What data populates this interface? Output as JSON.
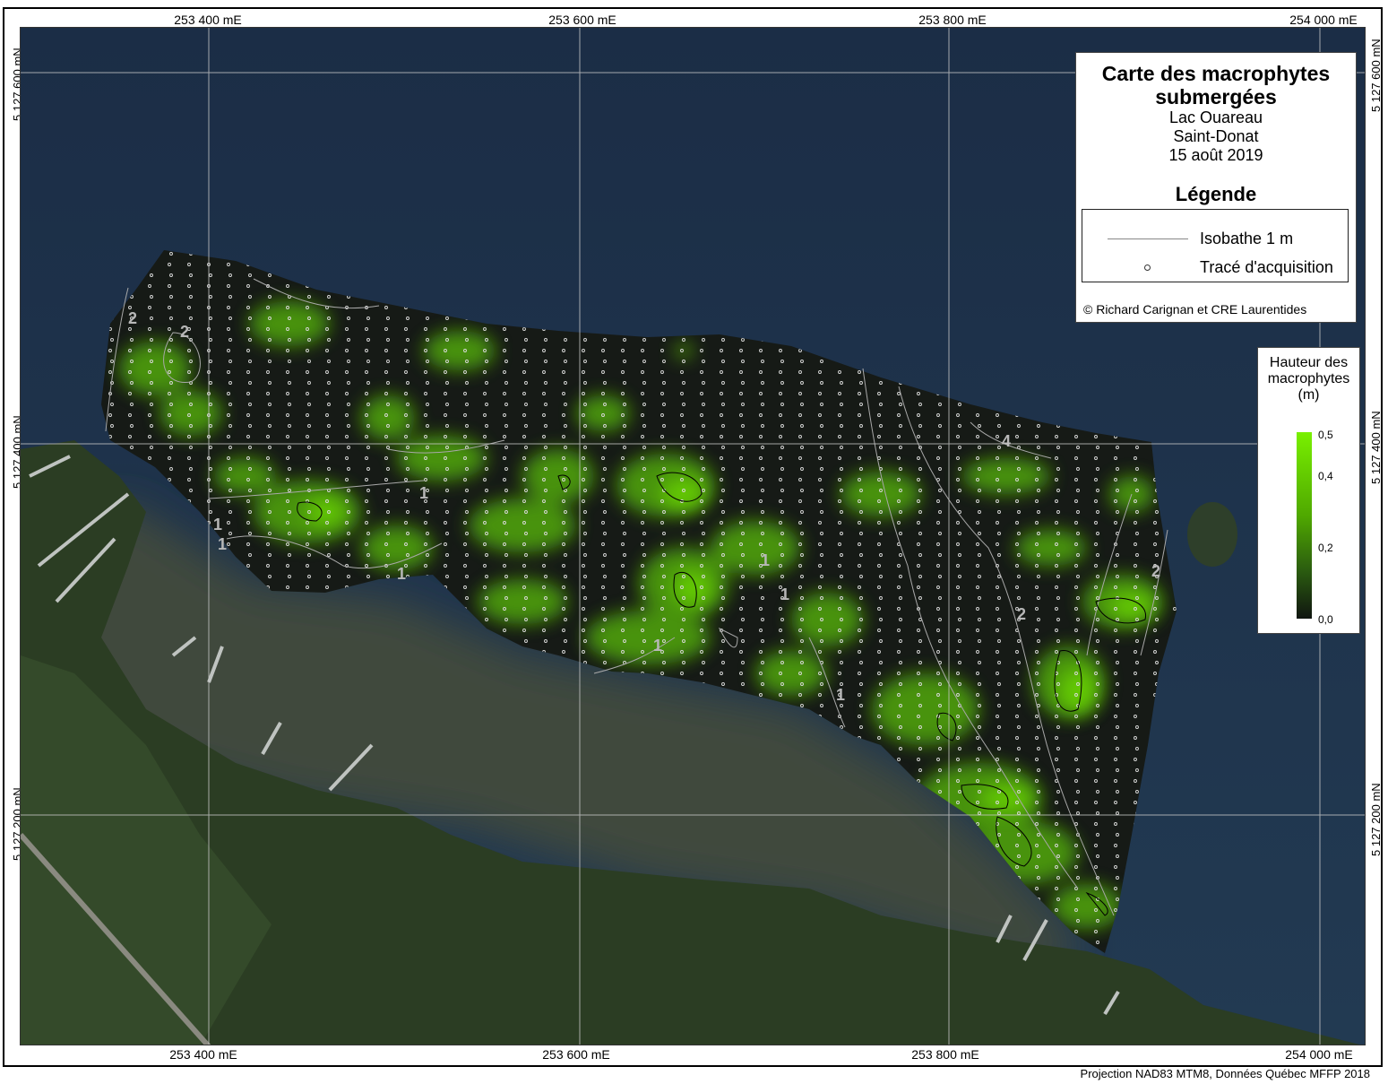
{
  "map": {
    "grid_x_top": [
      "253 400 mE",
      "253 600 mE",
      "253 800 mE",
      "254 000 mE"
    ],
    "grid_x_bottom": [
      "253 400 mE",
      "253 600 mE",
      "253 800 mE",
      "254 000 mE"
    ],
    "grid_y_left": [
      "5 127 600 mN",
      "5 127 400 mN",
      "5 127 200 mN"
    ],
    "grid_y_right": [
      "5 127 600 mN",
      "5 127 400 mN",
      "5 127 200 mN"
    ],
    "isobath_labels": [
      "2",
      "2",
      "1",
      "1",
      "1",
      "1",
      "1",
      "1",
      "1",
      "1",
      "4",
      "2",
      "2"
    ],
    "colors": {
      "water": "#1a2f47",
      "low": "#161a16",
      "high": "#6fe000",
      "grid": "#c8c8c8"
    }
  },
  "title": {
    "line1": "Carte des macrophytes",
    "line2": "submergées",
    "lake": "Lac Ouareau",
    "town": "Saint-Donat",
    "date": "15 août 2019"
  },
  "legend": {
    "heading": "Légende",
    "isobath": "Isobathe 1 m",
    "track": "Tracé d'acquisition",
    "copyright": "© Richard Carignan et CRE Laurentides"
  },
  "scale": {
    "title_line1": "Hauteur des",
    "title_line2": "macrophytes",
    "title_line3": "(m)",
    "labels": [
      "0,5",
      "0,4",
      "0,2",
      "0,0"
    ]
  },
  "footer": "Projection NAD83 MTM8, Données Québec MFFP 2018"
}
